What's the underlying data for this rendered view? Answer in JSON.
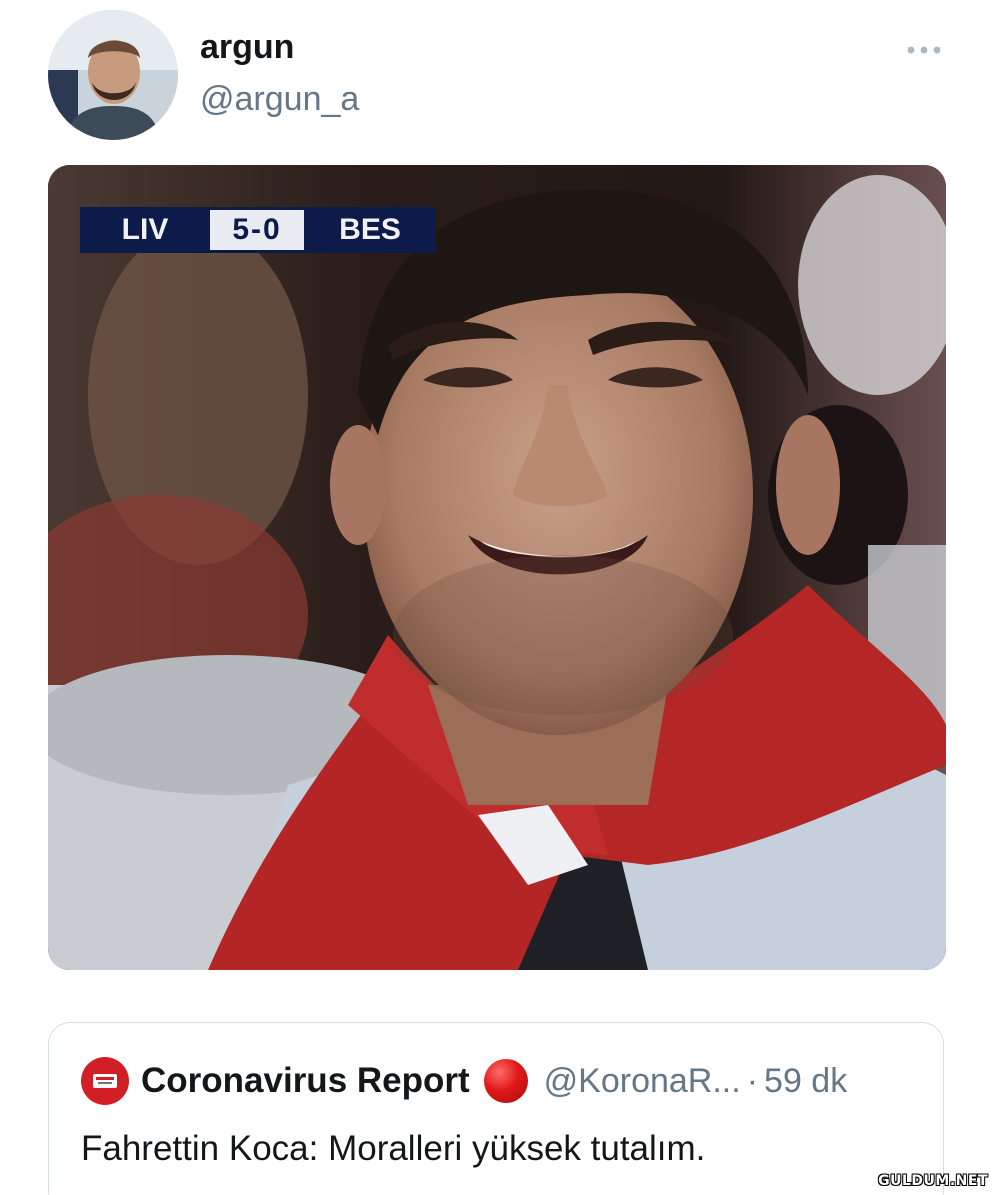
{
  "author": {
    "display_name": "argun",
    "handle": "@argun_a"
  },
  "media": {
    "scoreboard": {
      "home_team": "LIV",
      "score": "5-0",
      "away_team": "BES"
    }
  },
  "quoted_tweet": {
    "display_name": "Coronavirus Report",
    "handle": "@KoronaR...",
    "separator": "·",
    "time": "59 dk",
    "text": "Fahrettin Koca: Moralleri yüksek tutalım."
  },
  "watermark": "GULDUM.NET",
  "icons": {
    "more": "more-horizontal-icon",
    "status": "red-circle-icon"
  },
  "colors": {
    "secondary_text": "#657786",
    "border": "#d6dde3",
    "scorebug_bg": "#0d1b4a",
    "quote_avatar": "#d21f26"
  }
}
